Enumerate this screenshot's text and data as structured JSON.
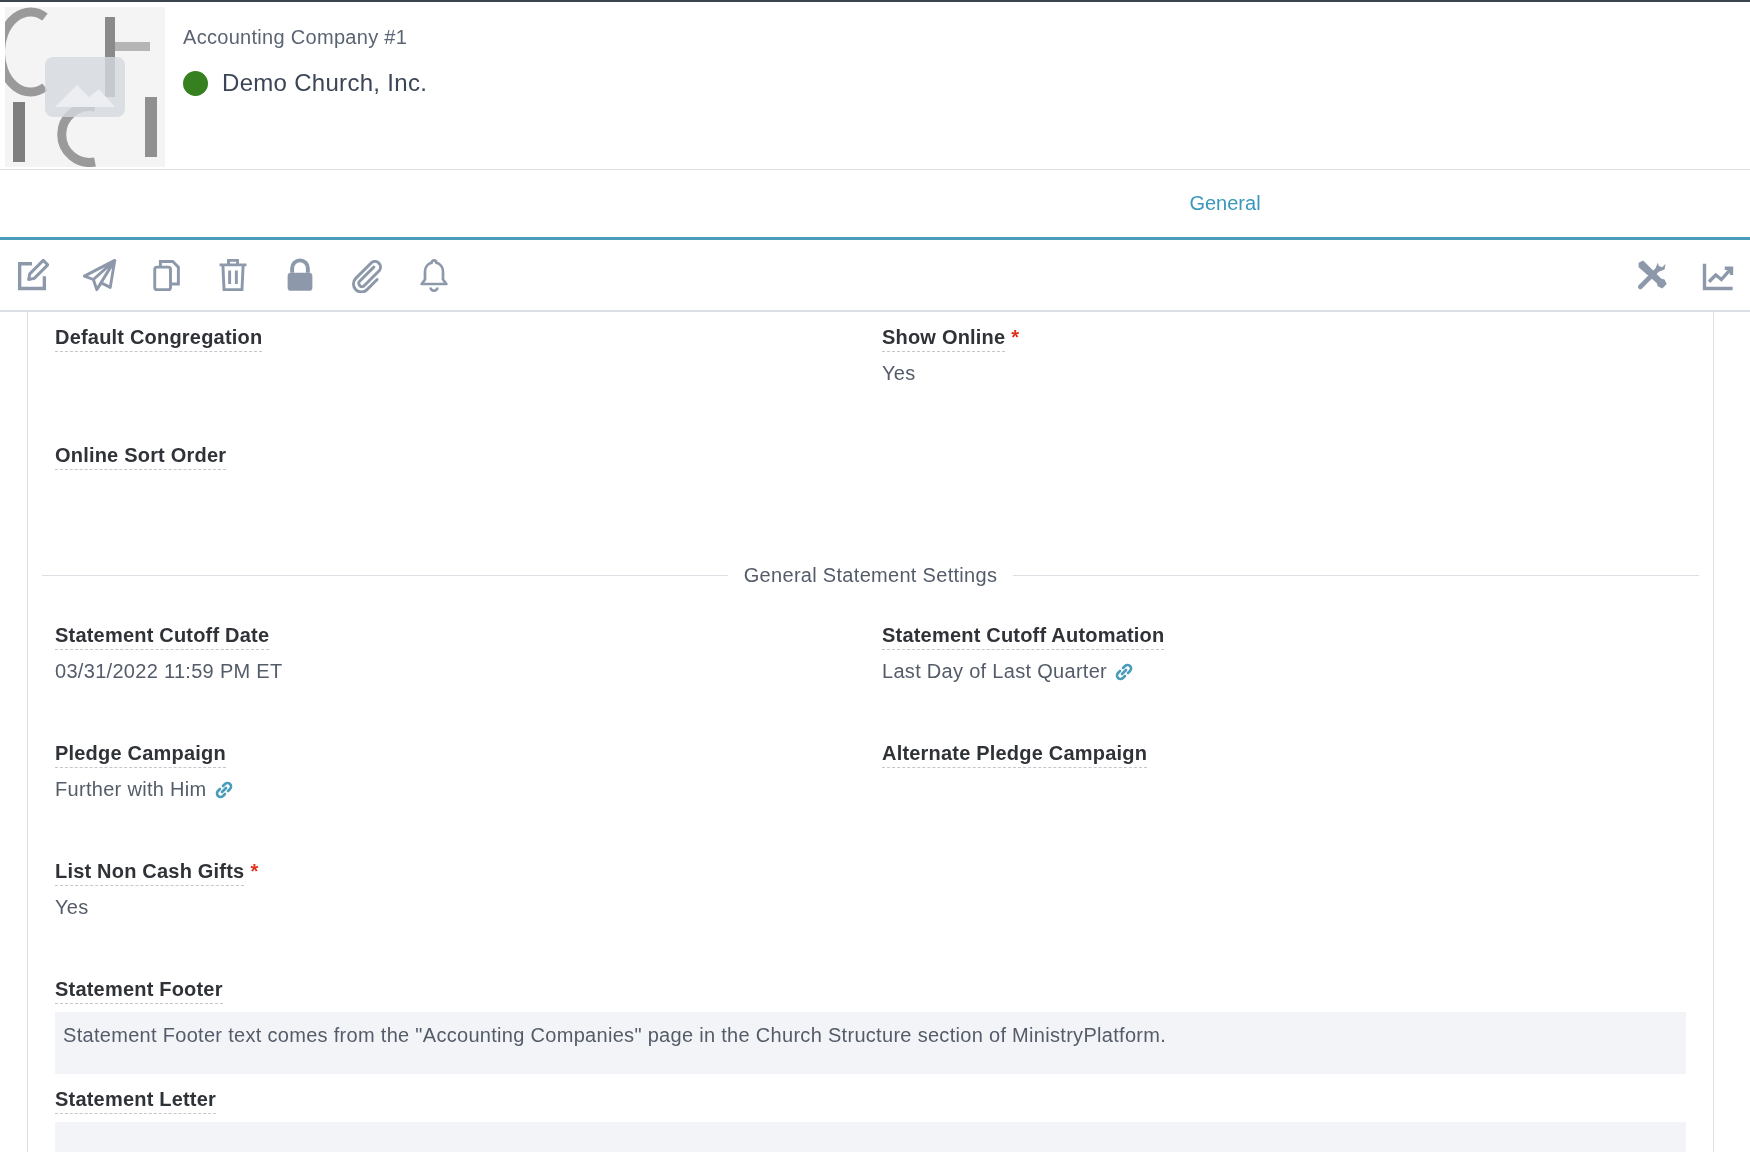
{
  "header": {
    "company_label": "Accounting Company #1",
    "title": "Demo Church, Inc.",
    "active": true
  },
  "tabs": [
    {
      "label": "General",
      "selected": true
    }
  ],
  "content": [
    {
      "kind": "pair",
      "fields": [
        {
          "label": "Default Congregation"
        },
        {
          "label": "Show Online",
          "marker": "*",
          "value": "Yes"
        }
      ]
    },
    {
      "kind": "pair",
      "fields": [
        {
          "label": "Online Sort Order"
        }
      ]
    },
    {
      "kind": "divider",
      "title": "General Statement Settings"
    },
    {
      "kind": "pair",
      "fields": [
        {
          "label": "Statement Cutoff Date",
          "value": "03/31/2022 11:59 PM ET"
        },
        {
          "label": "Statement Cutoff Automation",
          "value": "Last Day of Last Quarter",
          "linked": true
        }
      ]
    },
    {
      "kind": "pair",
      "fields": [
        {
          "label": "Pledge Campaign",
          "value": "Further with Him",
          "linked": true
        },
        {
          "label": "Alternate Pledge Campaign"
        }
      ]
    },
    {
      "kind": "pair",
      "fields": [
        {
          "label": "List Non Cash Gifts",
          "marker": "*",
          "value": "Yes"
        }
      ]
    },
    {
      "kind": "textblock",
      "label": "Statement Footer",
      "value": "Statement Footer text comes from the \"Accounting Companies\" page in the Church Structure section of MinistryPlatform."
    },
    {
      "kind": "textblock",
      "label": "Statement Letter"
    }
  ]
}
